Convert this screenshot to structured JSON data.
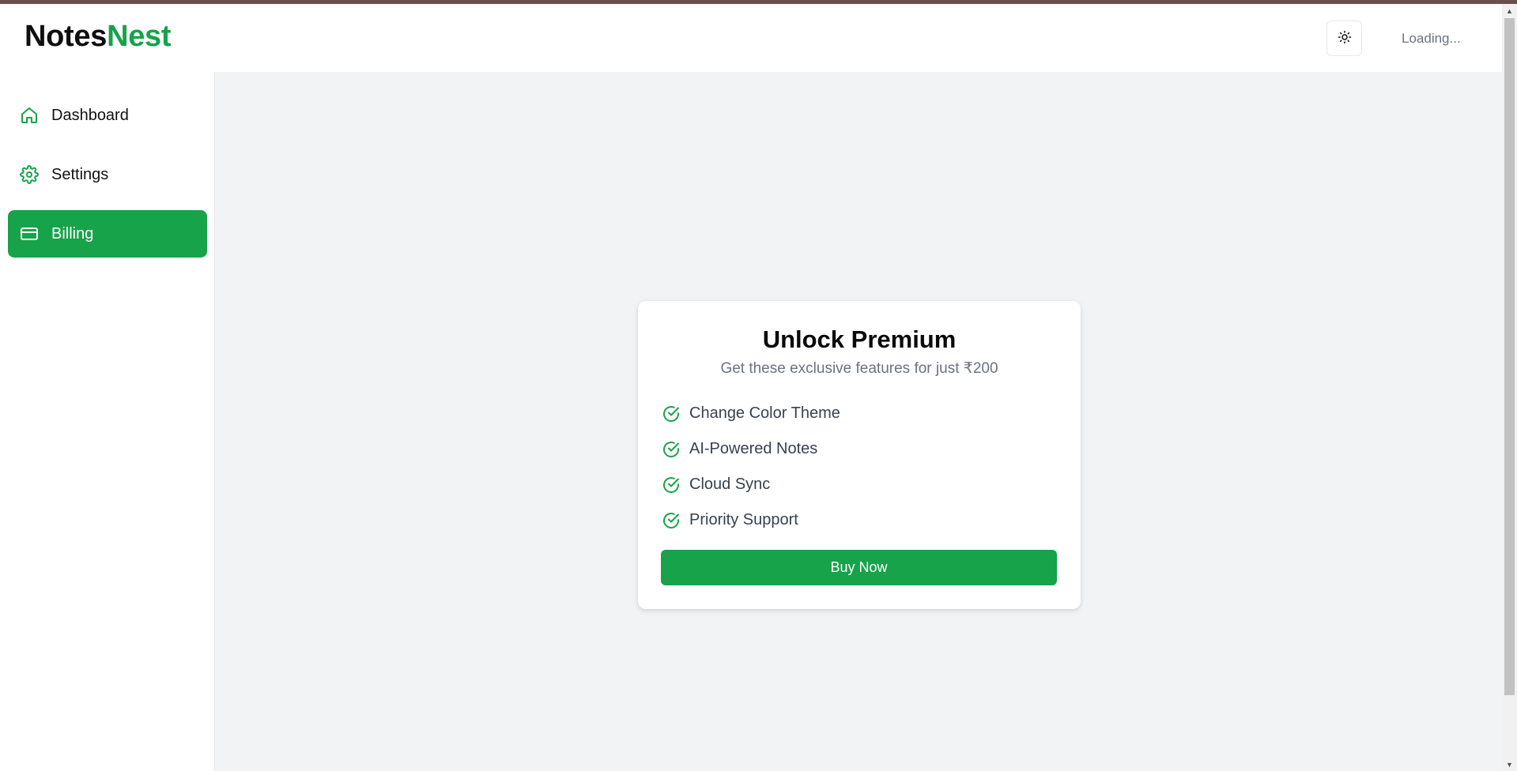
{
  "app": {
    "logo_part1": "Notes",
    "logo_part2": "Nest",
    "loading_text": "Loading...",
    "theme_toggle_icon": "sun-icon"
  },
  "sidebar": {
    "items": [
      {
        "label": "Dashboard",
        "icon": "home-icon",
        "active": false
      },
      {
        "label": "Settings",
        "icon": "gear-icon",
        "active": false
      },
      {
        "label": "Billing",
        "icon": "credit-card-icon",
        "active": true
      }
    ]
  },
  "card": {
    "title": "Unlock Premium",
    "subtitle": "Get these exclusive features for just ₹200",
    "features": [
      "Change Color Theme",
      "AI-Powered Notes",
      "Cloud Sync",
      "Priority Support"
    ],
    "button_label": "Buy Now"
  },
  "colors": {
    "brand_green": "#16a34a",
    "main_background": "#f2f3f5",
    "text_dark": "#111111",
    "text_muted": "#6b7280"
  }
}
